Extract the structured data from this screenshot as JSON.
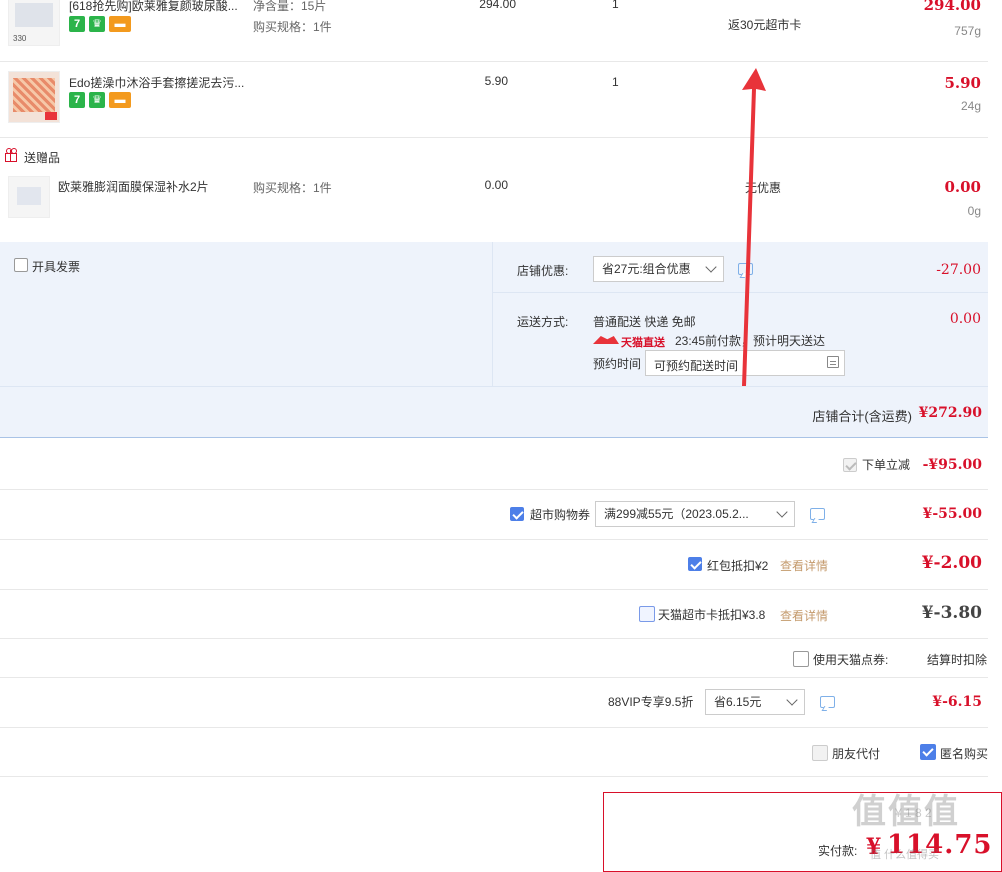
{
  "items": [
    {
      "title": "[618抢先购]欧莱雅复颜玻尿酸...",
      "spec_a": "净含量：15片",
      "spec_b": "购买规格：1件",
      "price": "294.00",
      "qty": "1",
      "promo": "返30元超市卡",
      "total": "294.00",
      "weight": "757g",
      "thumb_text": "330"
    },
    {
      "title": "Edo搓澡巾沐浴手套擦搓泥去污...",
      "price": "5.90",
      "qty": "1",
      "total": "5.90",
      "weight": "24g"
    }
  ],
  "gift": {
    "header": "送赠品",
    "title": "欧莱雅膨润面膜保湿补水2片",
    "spec": "购买规格：1件",
    "price": "0.00",
    "promo": "无优惠",
    "total": "0.00",
    "weight": "0g"
  },
  "invoice": {
    "label": "开具发票"
  },
  "shop_discount": {
    "label": "店铺优惠:",
    "value": "省27元:组合优惠",
    "amount": "-27.00"
  },
  "shipping": {
    "label": "运送方式:",
    "method": "普通配送 快递 免邮",
    "brand": "天猫直送",
    "eta": "23:45前付款，预计明天送达",
    "reserve_label": "预约时间",
    "reserve_placeholder": "可预约配送时间",
    "amount": "0.00"
  },
  "shop_total": {
    "label": "店铺合计(含运费)",
    "value": "¥272.90"
  },
  "discounts": {
    "instant": {
      "label": "下单立减",
      "amount": "-¥95.00"
    },
    "coupon": {
      "label": "超市购物券",
      "value": "满299减55元（2023.05.2...",
      "amount": "¥-55.00"
    },
    "redpack": {
      "label": "红包抵扣¥2",
      "link": "查看详情",
      "amount": "¥-2.00"
    },
    "tmcard": {
      "label": "天猫超市卡抵扣¥3.8",
      "link": "查看详情",
      "amount": "¥-3.80"
    },
    "points": {
      "label": "使用天猫点券:",
      "note": "结算时扣除"
    },
    "vip": {
      "label": "88VIP专享9.5折",
      "value": "省6.15元",
      "amount": "¥-6.15"
    }
  },
  "options": {
    "friend_pay": "朋友代付",
    "anonymous": "匿名购买"
  },
  "pay": {
    "label": "实付款:",
    "currency": "¥",
    "amount": "114.75",
    "watermark": "值 什么值得买",
    "faint": "¥ 1 8 2"
  },
  "colors": {
    "accent": "#d8102a",
    "checkbox": "#4d7fe8",
    "link": "#c49a6c",
    "panel": "#eef3fb",
    "arrow": "#e8333a"
  }
}
